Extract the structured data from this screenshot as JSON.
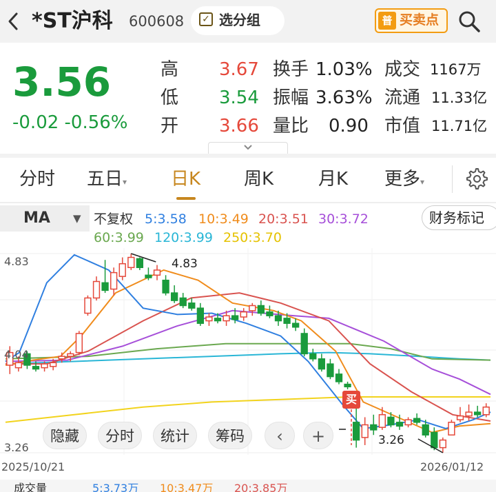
{
  "header": {
    "back_icon": "chevron-left-icon",
    "title": "*ST沪科",
    "code": "600608",
    "group_label": "选分组",
    "trade_icon_text": "普",
    "trade_label": "买卖点",
    "search_icon": "search-icon"
  },
  "quote": {
    "price": "3.56",
    "change": "-0.02  -0.56%",
    "high_label": "高",
    "high_value": "3.67",
    "low_label": "低",
    "low_value": "3.54",
    "open_label": "开",
    "open_value": "3.66",
    "turnover_label": "换手",
    "turnover_value": "1.03%",
    "amplitude_label": "振幅",
    "amplitude_value": "3.63%",
    "volume_ratio_label": "量比",
    "volume_ratio_value": "0.90",
    "amount_label": "成交",
    "amount_value": "1167万",
    "float_label": "流通",
    "float_value": "11.33亿",
    "mktcap_label": "市值",
    "mktcap_value": "11.71亿",
    "expand_icon": "chevron-down-icon"
  },
  "tabs": [
    {
      "label": "分时"
    },
    {
      "label": "五日"
    },
    {
      "label": "日K"
    },
    {
      "label": "周K"
    },
    {
      "label": "月K"
    },
    {
      "label": "更多"
    }
  ],
  "settings_icon": "gear-icon",
  "indicator": {
    "ma_label": "MA",
    "adjust_label": "不复权",
    "ma5": "5:3.58",
    "ma10": "10:3.49",
    "ma20": "20:3.51",
    "ma30": "30:3.72",
    "ma60": "60:3.99",
    "ma120": "120:3.99",
    "ma250": "250:3.70",
    "finance_label": "财务标记"
  },
  "colors": {
    "up": "#e5483a",
    "down": "#1a9b3c",
    "ma5": "#2f7fe0",
    "ma10": "#f08c1c",
    "ma20": "#d9534f",
    "ma30": "#a64fd9",
    "ma60": "#6aa84f",
    "ma120": "#29b6d6",
    "ma250": "#f2d31c"
  },
  "chart": {
    "y_max_label": "4.83",
    "y_mid_label": "4.04",
    "y_min_label": "3.26",
    "high_marker": "4.83",
    "low_marker": "3.26",
    "buy_marker": "买",
    "start_date": "2025/10/21",
    "end_date": "2026/01/12",
    "tools": [
      "隐藏",
      "分时",
      "统计",
      "筹码"
    ],
    "prev_icon": "chevron-left-icon",
    "add_icon": "plus-icon",
    "minus_icon": "minus-icon"
  },
  "chart_data": {
    "type": "candlestick",
    "ylim": [
      3.26,
      4.83
    ],
    "x_start": "2025/10/21",
    "x_end": "2026/01/12",
    "candles": [
      {
        "o": 3.95,
        "h": 4.1,
        "l": 3.88,
        "c": 4.05
      },
      {
        "o": 3.93,
        "h": 4.02,
        "l": 3.9,
        "c": 3.97
      },
      {
        "o": 4.04,
        "h": 4.06,
        "l": 3.92,
        "c": 3.95
      },
      {
        "o": 3.94,
        "h": 3.98,
        "l": 3.9,
        "c": 3.92
      },
      {
        "o": 3.93,
        "h": 3.98,
        "l": 3.9,
        "c": 3.96
      },
      {
        "o": 3.94,
        "h": 4.0,
        "l": 3.91,
        "c": 3.97
      },
      {
        "o": 4.0,
        "h": 4.05,
        "l": 3.97,
        "c": 4.02
      },
      {
        "o": 4.02,
        "h": 4.06,
        "l": 3.98,
        "c": 4.04
      },
      {
        "o": 4.05,
        "h": 4.22,
        "l": 4.03,
        "c": 4.2
      },
      {
        "o": 4.36,
        "h": 4.5,
        "l": 4.34,
        "c": 4.48
      },
      {
        "o": 4.48,
        "h": 4.65,
        "l": 4.46,
        "c": 4.61
      },
      {
        "o": 4.6,
        "h": 4.78,
        "l": 4.52,
        "c": 4.54
      },
      {
        "o": 4.55,
        "h": 4.72,
        "l": 4.5,
        "c": 4.68
      },
      {
        "o": 4.65,
        "h": 4.8,
        "l": 4.62,
        "c": 4.75
      },
      {
        "o": 4.72,
        "h": 4.83,
        "l": 4.7,
        "c": 4.8
      },
      {
        "o": 4.79,
        "h": 4.8,
        "l": 4.7,
        "c": 4.72
      },
      {
        "o": 4.66,
        "h": 4.72,
        "l": 4.62,
        "c": 4.64
      },
      {
        "o": 4.66,
        "h": 4.74,
        "l": 4.62,
        "c": 4.7
      },
      {
        "o": 4.62,
        "h": 4.66,
        "l": 4.5,
        "c": 4.52
      },
      {
        "o": 4.52,
        "h": 4.58,
        "l": 4.44,
        "c": 4.46
      },
      {
        "o": 4.48,
        "h": 4.52,
        "l": 4.4,
        "c": 4.42
      },
      {
        "o": 4.44,
        "h": 4.48,
        "l": 4.38,
        "c": 4.4
      },
      {
        "o": 4.4,
        "h": 4.44,
        "l": 4.26,
        "c": 4.28
      },
      {
        "o": 4.3,
        "h": 4.36,
        "l": 4.26,
        "c": 4.33
      },
      {
        "o": 4.32,
        "h": 4.36,
        "l": 4.28,
        "c": 4.3
      },
      {
        "o": 4.3,
        "h": 4.38,
        "l": 4.26,
        "c": 4.34
      },
      {
        "o": 4.34,
        "h": 4.4,
        "l": 4.28,
        "c": 4.31
      },
      {
        "o": 4.33,
        "h": 4.4,
        "l": 4.3,
        "c": 4.37
      },
      {
        "o": 4.38,
        "h": 4.44,
        "l": 4.34,
        "c": 4.42
      },
      {
        "o": 4.42,
        "h": 4.46,
        "l": 4.34,
        "c": 4.36
      },
      {
        "o": 4.37,
        "h": 4.42,
        "l": 4.32,
        "c": 4.34
      },
      {
        "o": 4.34,
        "h": 4.38,
        "l": 4.26,
        "c": 4.3
      },
      {
        "o": 4.32,
        "h": 4.36,
        "l": 4.24,
        "c": 4.28
      },
      {
        "o": 4.28,
        "h": 4.32,
        "l": 4.22,
        "c": 4.25
      },
      {
        "o": 4.2,
        "h": 4.24,
        "l": 4.02,
        "c": 4.04
      },
      {
        "o": 4.04,
        "h": 4.08,
        "l": 3.98,
        "c": 4.0
      },
      {
        "o": 4.0,
        "h": 4.04,
        "l": 3.9,
        "c": 3.92
      },
      {
        "o": 3.96,
        "h": 4.0,
        "l": 3.84,
        "c": 3.86
      },
      {
        "o": 3.88,
        "h": 3.92,
        "l": 3.8,
        "c": 3.82
      },
      {
        "o": 3.8,
        "h": 3.82,
        "l": 3.76,
        "c": 3.78
      },
      {
        "o": 3.5,
        "h": 3.7,
        "l": 3.3,
        "c": 3.36
      },
      {
        "o": 3.38,
        "h": 3.54,
        "l": 3.32,
        "c": 3.48
      },
      {
        "o": 3.48,
        "h": 3.56,
        "l": 3.4,
        "c": 3.44
      },
      {
        "o": 3.46,
        "h": 3.62,
        "l": 3.44,
        "c": 3.56
      },
      {
        "o": 3.54,
        "h": 3.58,
        "l": 3.46,
        "c": 3.48
      },
      {
        "o": 3.5,
        "h": 3.56,
        "l": 3.44,
        "c": 3.47
      },
      {
        "o": 3.48,
        "h": 3.54,
        "l": 3.46,
        "c": 3.52
      },
      {
        "o": 3.53,
        "h": 3.57,
        "l": 3.48,
        "c": 3.5
      },
      {
        "o": 3.48,
        "h": 3.52,
        "l": 3.38,
        "c": 3.4
      },
      {
        "o": 3.42,
        "h": 3.46,
        "l": 3.28,
        "c": 3.3
      },
      {
        "o": 3.3,
        "h": 3.38,
        "l": 3.26,
        "c": 3.36
      },
      {
        "o": 3.4,
        "h": 3.52,
        "l": 3.4,
        "c": 3.5
      },
      {
        "o": 3.52,
        "h": 3.62,
        "l": 3.5,
        "c": 3.55
      },
      {
        "o": 3.55,
        "h": 3.64,
        "l": 3.51,
        "c": 3.58
      },
      {
        "o": 3.58,
        "h": 3.63,
        "l": 3.54,
        "c": 3.56
      },
      {
        "o": 3.56,
        "h": 3.65,
        "l": 3.54,
        "c": 3.62
      }
    ],
    "ma": {
      "ma5": [
        [
          0,
          3.98
        ],
        [
          20,
          4.05
        ],
        [
          60,
          4.6
        ],
        [
          100,
          4.82
        ],
        [
          150,
          4.7
        ],
        [
          200,
          4.4
        ],
        [
          250,
          4.35
        ],
        [
          300,
          4.36
        ],
        [
          350,
          4.28
        ],
        [
          400,
          4.18
        ],
        [
          440,
          3.98
        ],
        [
          490,
          3.64
        ],
        [
          520,
          3.45
        ],
        [
          560,
          3.48
        ],
        [
          600,
          3.52
        ],
        [
          640,
          3.45
        ],
        [
          680,
          3.52
        ],
        [
          705,
          3.58
        ]
      ],
      "ma10": [
        [
          0,
          3.95
        ],
        [
          40,
          3.99
        ],
        [
          80,
          4.02
        ],
        [
          110,
          4.18
        ],
        [
          160,
          4.52
        ],
        [
          230,
          4.7
        ],
        [
          280,
          4.62
        ],
        [
          330,
          4.44
        ],
        [
          390,
          4.38
        ],
        [
          430,
          4.3
        ],
        [
          480,
          4.06
        ],
        [
          520,
          3.66
        ],
        [
          570,
          3.54
        ],
        [
          620,
          3.42
        ],
        [
          660,
          3.47
        ],
        [
          705,
          3.49
        ]
      ],
      "ma20": [
        [
          0,
          3.96
        ],
        [
          60,
          3.96
        ],
        [
          120,
          4.06
        ],
        [
          200,
          4.3
        ],
        [
          270,
          4.48
        ],
        [
          340,
          4.52
        ],
        [
          400,
          4.44
        ],
        [
          470,
          4.3
        ],
        [
          530,
          3.96
        ],
        [
          590,
          3.74
        ],
        [
          650,
          3.56
        ],
        [
          705,
          3.51
        ]
      ],
      "ma30": [
        [
          0,
          3.98
        ],
        [
          90,
          3.99
        ],
        [
          170,
          4.1
        ],
        [
          250,
          4.26
        ],
        [
          330,
          4.38
        ],
        [
          420,
          4.34
        ],
        [
          470,
          4.32
        ],
        [
          550,
          4.14
        ],
        [
          620,
          3.92
        ],
        [
          660,
          3.84
        ],
        [
          705,
          3.72
        ]
      ],
      "ma60": [
        [
          0,
          4.0
        ],
        [
          120,
          4.02
        ],
        [
          220,
          4.08
        ],
        [
          320,
          4.12
        ],
        [
          420,
          4.12
        ],
        [
          500,
          4.12
        ],
        [
          560,
          4.08
        ],
        [
          620,
          4.0
        ],
        [
          705,
          3.99
        ]
      ],
      "ma120": [
        [
          0,
          3.96
        ],
        [
          100,
          3.98
        ],
        [
          200,
          4.0
        ],
        [
          300,
          4.02
        ],
        [
          400,
          4.04
        ],
        [
          470,
          4.05
        ],
        [
          530,
          4.04
        ],
        [
          600,
          4.02
        ],
        [
          660,
          4.0
        ],
        [
          705,
          3.99
        ]
      ],
      "ma250": [
        [
          0,
          3.5
        ],
        [
          100,
          3.56
        ],
        [
          200,
          3.62
        ],
        [
          300,
          3.66
        ],
        [
          400,
          3.68
        ],
        [
          500,
          3.7
        ],
        [
          600,
          3.7
        ],
        [
          705,
          3.7
        ]
      ]
    }
  },
  "volume_legend": {
    "title": "成交量",
    "ma5": "5:3.73万",
    "ma10": "10:3.47万",
    "ma20": "20:3.85万"
  }
}
